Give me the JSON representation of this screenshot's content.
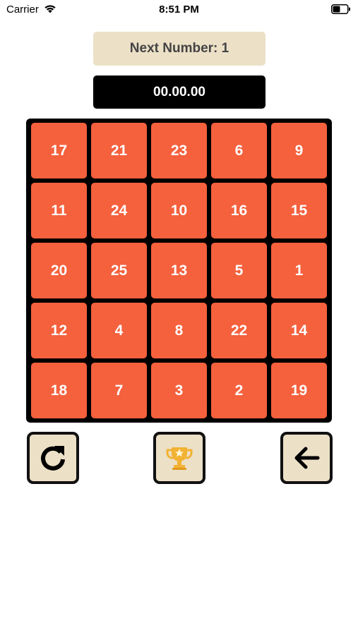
{
  "status_bar": {
    "carrier": "Carrier",
    "time": "8:51 PM",
    "wifi_icon": "wifi-icon",
    "battery_icon": "battery-icon"
  },
  "game": {
    "next_label": "Next Number:",
    "next_value": "1",
    "timer": "00.00.00",
    "tiles": [
      "17",
      "21",
      "23",
      "6",
      "9",
      "11",
      "24",
      "10",
      "16",
      "15",
      "20",
      "25",
      "13",
      "5",
      "1",
      "12",
      "4",
      "8",
      "22",
      "14",
      "18",
      "7",
      "3",
      "2",
      "19"
    ]
  },
  "controls": {
    "restart_icon": "restart-icon",
    "trophy_icon": "trophy-icon",
    "back_icon": "back-arrow-icon"
  },
  "colors": {
    "tile": "#f5603d",
    "banner": "#ece0c7",
    "board": "#000000",
    "trophy": "#f2b233"
  }
}
